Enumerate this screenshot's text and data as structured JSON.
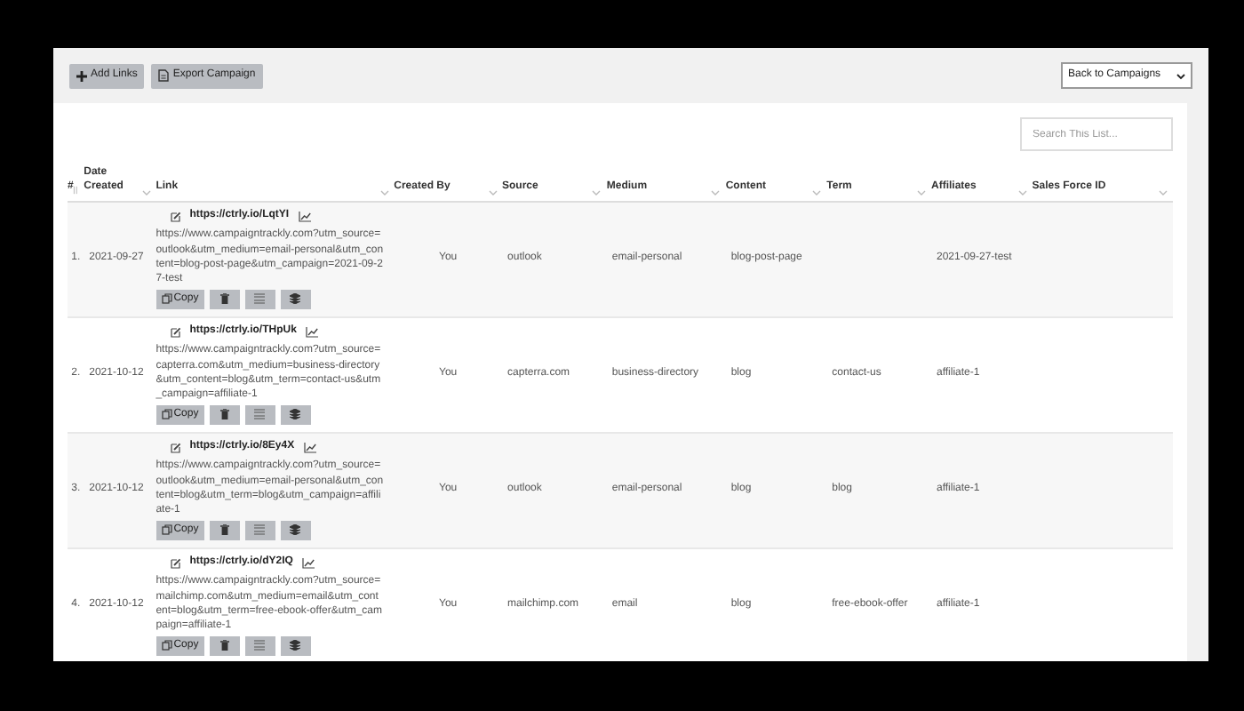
{
  "toolbar": {
    "buttons": [
      {
        "label": "Add Links"
      },
      {
        "label": "Export Campaign"
      }
    ],
    "dropdown": {
      "value": "Back to Campaigns"
    }
  },
  "search": {
    "placeholder": "Search This List..."
  },
  "table": {
    "columns": [
      "#",
      "Date Created",
      "Link",
      "Created By",
      "Source",
      "Medium",
      "Content",
      "Term",
      "Affiliates",
      "Sales Force ID"
    ],
    "rows": [
      {
        "number": "1.",
        "date": "2021-09-27",
        "short_link": "https://ctrly.io/LqtYI",
        "long_link": "https://www.campaigntrackly.com?utm_source=outlook&utm_medium=email-personal&utm_content=blog-post-page&utm_campaign=2021-09-27-test",
        "copy": "Copy",
        "created_by": "You",
        "source": "outlook",
        "medium": "email-personal",
        "content": "blog-post-page",
        "affiliates": "2021-09-27-test"
      },
      {
        "number": "2.",
        "date": "2021-10-12",
        "short_link": "https://ctrly.io/THpUk",
        "long_link": "https://www.campaigntrackly.com?utm_source=capterra.com&utm_medium=business-directory&utm_content=blog&utm_term=contact-us&utm_campaign=affiliate-1",
        "copy": "Copy",
        "created_by": "You",
        "source": "capterra.com",
        "medium": "business-directory",
        "content": "blog",
        "term": "contact-us",
        "affiliates": "affiliate-1"
      },
      {
        "number": "3.",
        "date": "2021-10-12",
        "short_link": "https://ctrly.io/8Ey4X",
        "long_link": "https://www.campaigntrackly.com?utm_source=outlook&utm_medium=email-personal&utm_content=blog&utm_term=blog&utm_campaign=affiliate-1",
        "copy": "Copy",
        "created_by": "You",
        "source": "outlook",
        "medium": "email-personal",
        "content": "blog",
        "term": "blog",
        "affiliates": "affiliate-1"
      },
      {
        "number": "4.",
        "date": "2021-10-12",
        "short_link": "https://ctrly.io/dY2IQ",
        "long_link": "https://www.campaigntrackly.com?utm_source=mailchimp.com&utm_medium=email&utm_content=blog&utm_term=free-ebook-offer&utm_campaign=affiliate-1",
        "copy": "Copy",
        "created_by": "You",
        "source": "mailchimp.com",
        "medium": "email",
        "content": "blog",
        "term": "free-ebook-offer",
        "affiliates": "affiliate-1"
      }
    ]
  }
}
